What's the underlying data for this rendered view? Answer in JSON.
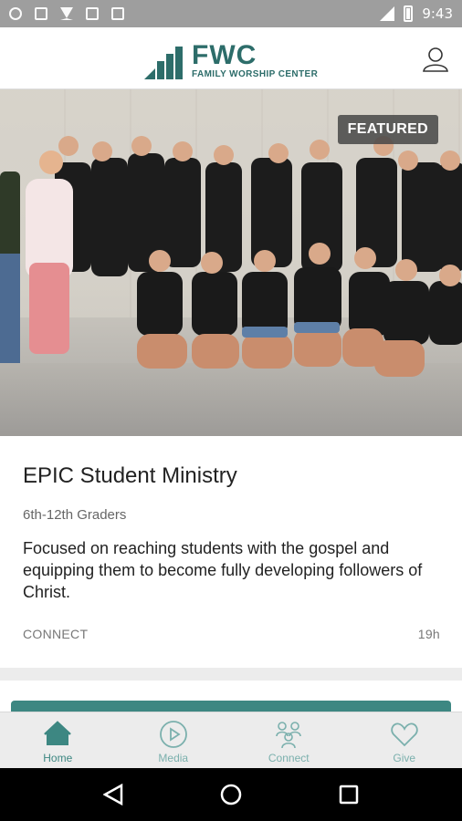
{
  "status_bar": {
    "time": "9:43"
  },
  "header": {
    "logo_big": "FWC",
    "logo_small": "FAMILY WORSHIP CENTER"
  },
  "card": {
    "badge": "FEATURED",
    "title": "EPIC Student Ministry",
    "subtitle": "6th-12th Graders",
    "description": "Focused on reaching students with the gospel and equipping them to become fully developing followers of Christ.",
    "category": "CONNECT",
    "age": "19h"
  },
  "nav": {
    "items": [
      {
        "label": "Home",
        "icon": "home-icon"
      },
      {
        "label": "Media",
        "icon": "play-icon"
      },
      {
        "label": "Connect",
        "icon": "people-icon"
      },
      {
        "label": "Give",
        "icon": "heart-icon"
      }
    ]
  },
  "colors": {
    "accent": "#3d8782",
    "brand": "#2d6d6a"
  }
}
